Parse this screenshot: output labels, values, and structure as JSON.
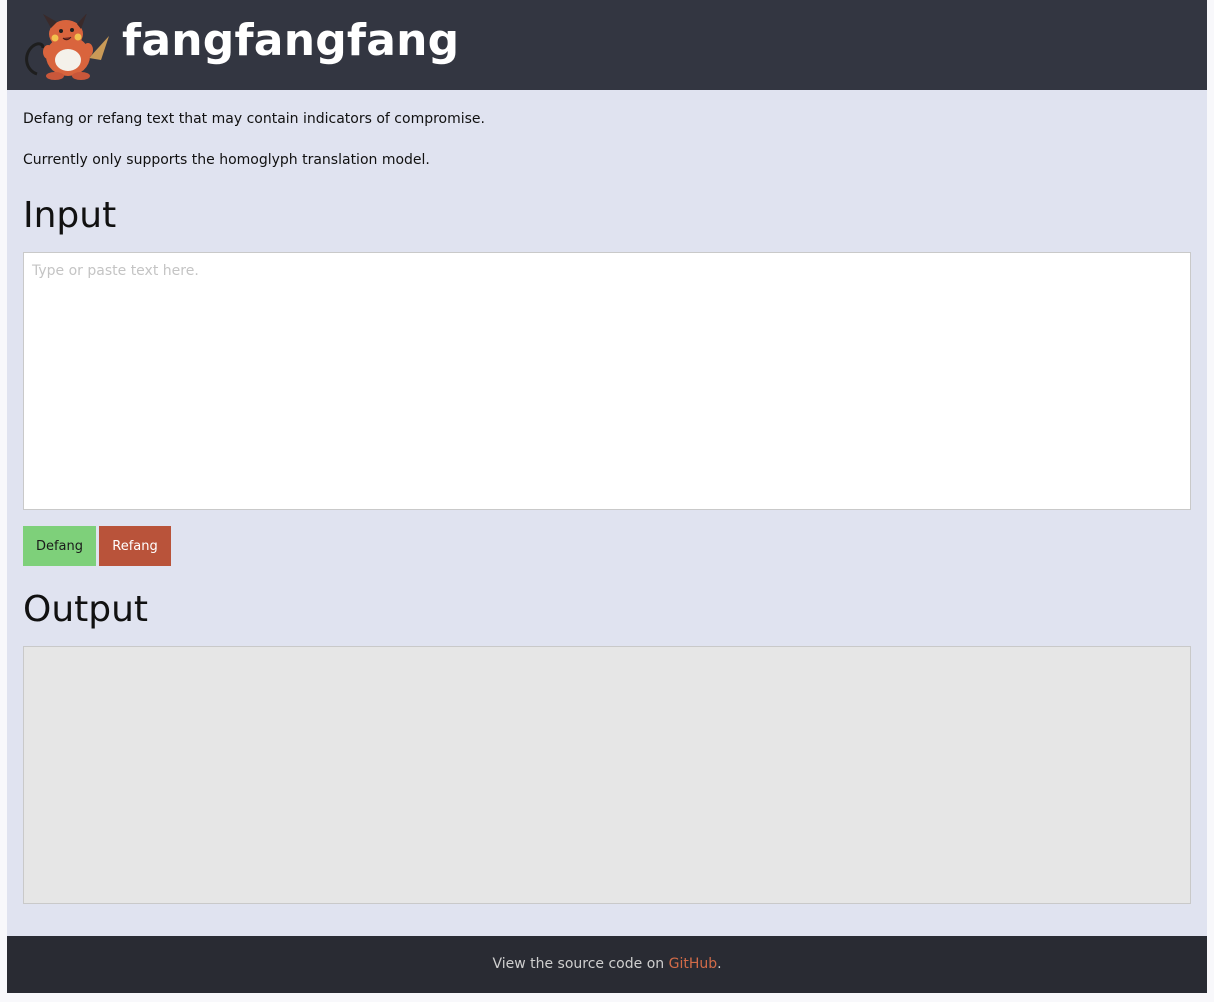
{
  "header": {
    "title": "fangfangfang"
  },
  "intro": {
    "line1": "Defang or refang text that may contain indicators of compromise.",
    "line2": "Currently only supports the homoglyph translation model."
  },
  "input": {
    "heading": "Input",
    "placeholder": "Type or paste text here.",
    "value": ""
  },
  "buttons": {
    "defang_label": "Defang",
    "refang_label": "Refang"
  },
  "output": {
    "heading": "Output",
    "value": ""
  },
  "footer": {
    "text_before": "View the source code on ",
    "link_text": "GitHub",
    "text_after": "."
  },
  "colors": {
    "header_bg": "#333641",
    "page_bg": "#e0e3f0",
    "defang_button": "#7ed07a",
    "refang_button": "#b9533a",
    "footer_bg": "#292b33",
    "link": "#d26b48"
  },
  "icons": {
    "logo": "raichu-mascot-icon"
  }
}
